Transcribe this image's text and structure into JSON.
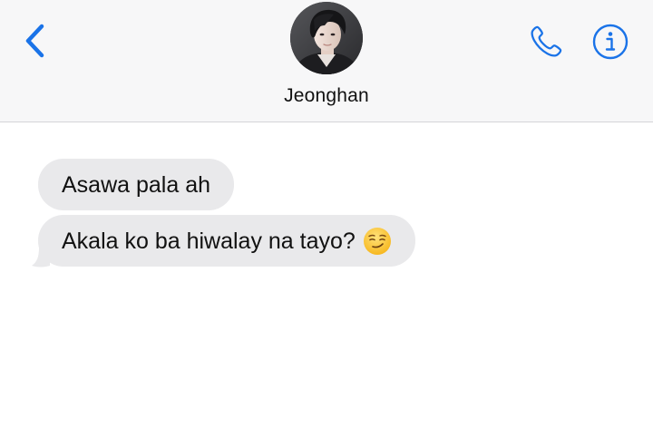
{
  "header": {
    "back_icon": "chevron-left-icon",
    "contact_name": "Jeonghan",
    "avatar": "contact-photo",
    "call_icon": "phone-icon",
    "info_icon": "info-icon",
    "accent_color": "#1a73e8"
  },
  "messages": [
    {
      "direction": "incoming",
      "text": "Asawa pala ah"
    },
    {
      "direction": "incoming",
      "text": "Akala ko ba hiwalay na tayo?",
      "emoji": "smirking-face"
    }
  ],
  "colors": {
    "header_bg": "#f7f7f8",
    "incoming_bubble": "#e9e9eb",
    "background": "#ffffff"
  }
}
